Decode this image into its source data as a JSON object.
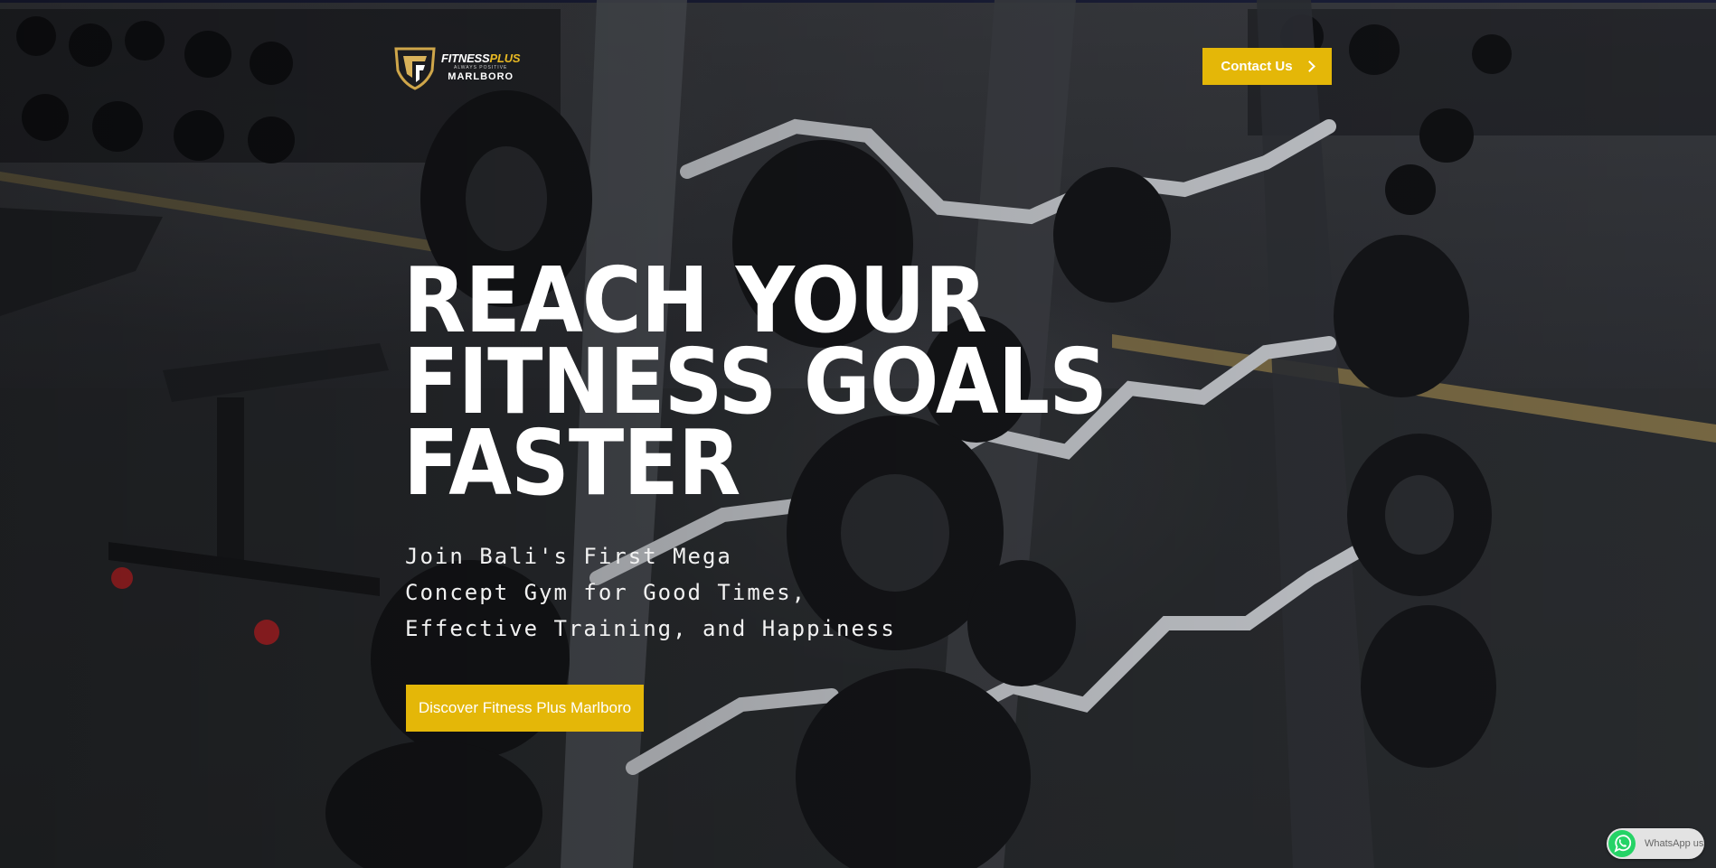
{
  "brand": {
    "name_part1": "FITNESS",
    "name_part2": "PLUS",
    "tagline": "ALWAYS POSITIVE",
    "location": "MARLBORO"
  },
  "header": {
    "contact_label": "Contact Us"
  },
  "hero": {
    "headline_lines": [
      "REACH YOUR",
      "FITNESS GOALS",
      "FASTER"
    ],
    "subtext_lines": [
      "Join Bali's First Mega",
      "Concept Gym for Good Times,",
      "Effective Training, and Happiness"
    ],
    "cta_label": "Discover Fitness Plus Marlboro"
  },
  "whatsapp": {
    "label": "WhatsApp us"
  },
  "colors": {
    "accent": "#e4b708",
    "text": "#ffffff",
    "whatsapp_green": "#25d366"
  },
  "icons": [
    "fitnessplus-logo",
    "chevron-right-icon",
    "whatsapp-icon"
  ]
}
